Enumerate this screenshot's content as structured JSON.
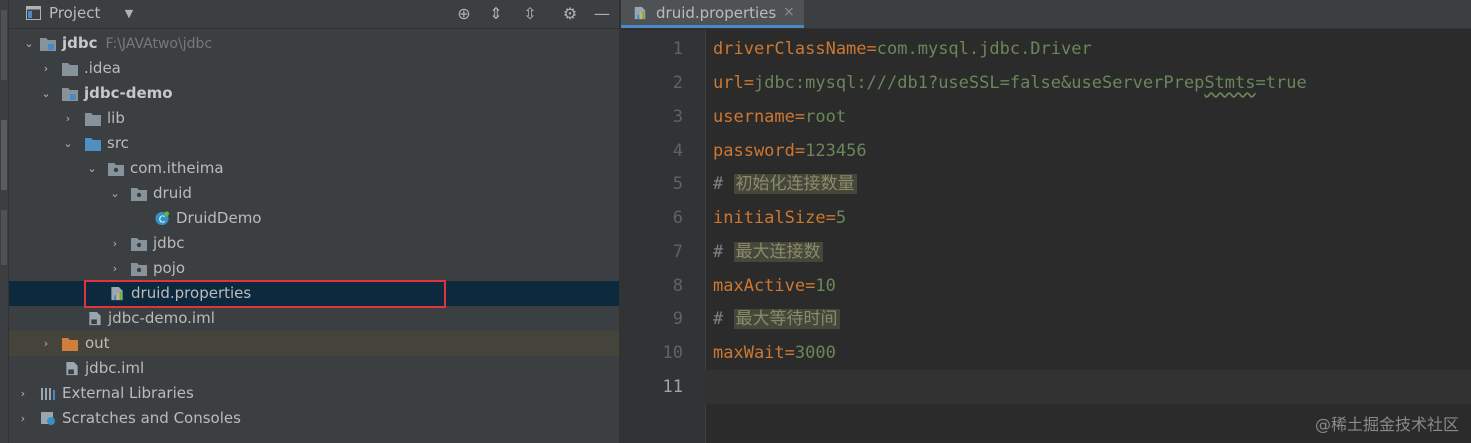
{
  "project_panel": {
    "title": "Project",
    "tree": [
      {
        "label": "jdbc",
        "path": "F:\\JAVAtwo\\jdbc",
        "icon": "module-folder-icon",
        "arrow": "expanded"
      },
      {
        "label": ".idea",
        "icon": "folder-icon",
        "arrow": "collapsed"
      },
      {
        "label": "jdbc-demo",
        "icon": "module-folder-icon",
        "arrow": "expanded"
      },
      {
        "label": "lib",
        "icon": "folder-icon",
        "arrow": "collapsed"
      },
      {
        "label": "src",
        "icon": "source-folder-icon",
        "arrow": "expanded"
      },
      {
        "label": "com.itheima",
        "icon": "package-icon",
        "arrow": "expanded"
      },
      {
        "label": "druid",
        "icon": "package-icon",
        "arrow": "expanded"
      },
      {
        "label": "DruidDemo",
        "icon": "java-class-icon",
        "arrow": "none"
      },
      {
        "label": "jdbc",
        "icon": "package-icon",
        "arrow": "collapsed"
      },
      {
        "label": "pojo",
        "icon": "package-icon",
        "arrow": "collapsed"
      },
      {
        "label": "druid.properties",
        "icon": "properties-file-icon",
        "arrow": "none"
      },
      {
        "label": "jdbc-demo.iml",
        "icon": "iml-file-icon",
        "arrow": "none"
      },
      {
        "label": "out",
        "icon": "excluded-folder-icon",
        "arrow": "collapsed"
      },
      {
        "label": "jdbc.iml",
        "icon": "iml-file-icon",
        "arrow": "none"
      },
      {
        "label": "External Libraries",
        "icon": "libraries-icon",
        "arrow": "collapsed"
      },
      {
        "label": "Scratches and Consoles",
        "icon": "scratches-icon",
        "arrow": "collapsed"
      }
    ]
  },
  "editor": {
    "tab_label": "druid.properties",
    "tab_close": "×",
    "line_numbers": [
      "1",
      "2",
      "3",
      "4",
      "5",
      "6",
      "7",
      "8",
      "9",
      "10",
      "11"
    ],
    "lines": [
      {
        "key": "driverClassName",
        "value": "com.mysql.jdbc.Driver"
      },
      {
        "key": "url",
        "value_a": "jdbc:mysql:///db1?useSSL=false&useServerPrep",
        "value_b": "Stmts",
        "value_c": "=true"
      },
      {
        "key": "username",
        "value": "root"
      },
      {
        "key": "password",
        "value": "123456"
      },
      {
        "comment_prefix": "#",
        "comment_text": "初始化连接数量"
      },
      {
        "key": "initialSize",
        "value": "5"
      },
      {
        "comment_prefix": "#",
        "comment_text": "最大连接数"
      },
      {
        "key": "maxActive",
        "value": "10"
      },
      {
        "comment_prefix": "#",
        "comment_text": "最大等待时间"
      },
      {
        "key": "maxWait",
        "value": "3000"
      }
    ]
  },
  "watermark": "@稀土掘金技术社区",
  "colors": {
    "selection": "#0d293e",
    "highlight_box": "#e0343a",
    "key": "#cc7832",
    "value": "#6a8759"
  }
}
